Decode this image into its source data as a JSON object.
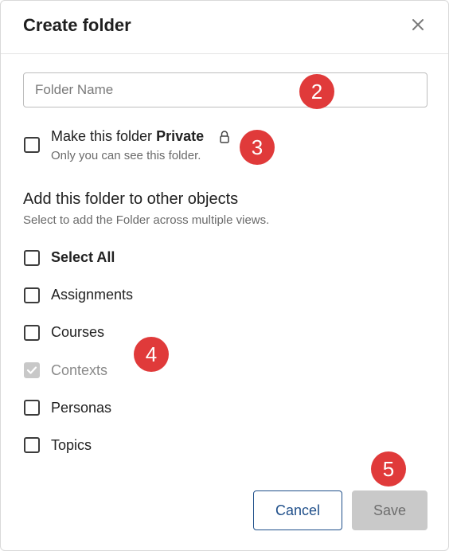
{
  "dialog": {
    "title": "Create folder",
    "close_icon": "close-icon",
    "folder_name_placeholder": "Folder Name",
    "private": {
      "label_prefix": "Make this folder ",
      "label_bold": "Private",
      "lock_icon": "lock-icon",
      "subtext": "Only you can see this folder."
    },
    "objects_section": {
      "title": "Add this folder to other objects",
      "subtext": "Select to add the Folder across multiple views.",
      "options": [
        {
          "label": "Select All",
          "checked": false,
          "disabled": false
        },
        {
          "label": "Assignments",
          "checked": false,
          "disabled": false
        },
        {
          "label": "Courses",
          "checked": false,
          "disabled": false
        },
        {
          "label": "Contexts",
          "checked": true,
          "disabled": true
        },
        {
          "label": "Personas",
          "checked": false,
          "disabled": false
        },
        {
          "label": "Topics",
          "checked": false,
          "disabled": false
        }
      ]
    },
    "buttons": {
      "cancel": "Cancel",
      "save": "Save"
    }
  },
  "annotations": {
    "badge_name_field": "2",
    "badge_private": "3",
    "badge_objects": "4",
    "badge_buttons": "5",
    "badge_color": "#e03a3a"
  },
  "colors": {
    "primary": "#1f4f8a",
    "disabled": "#c9c9c9"
  }
}
